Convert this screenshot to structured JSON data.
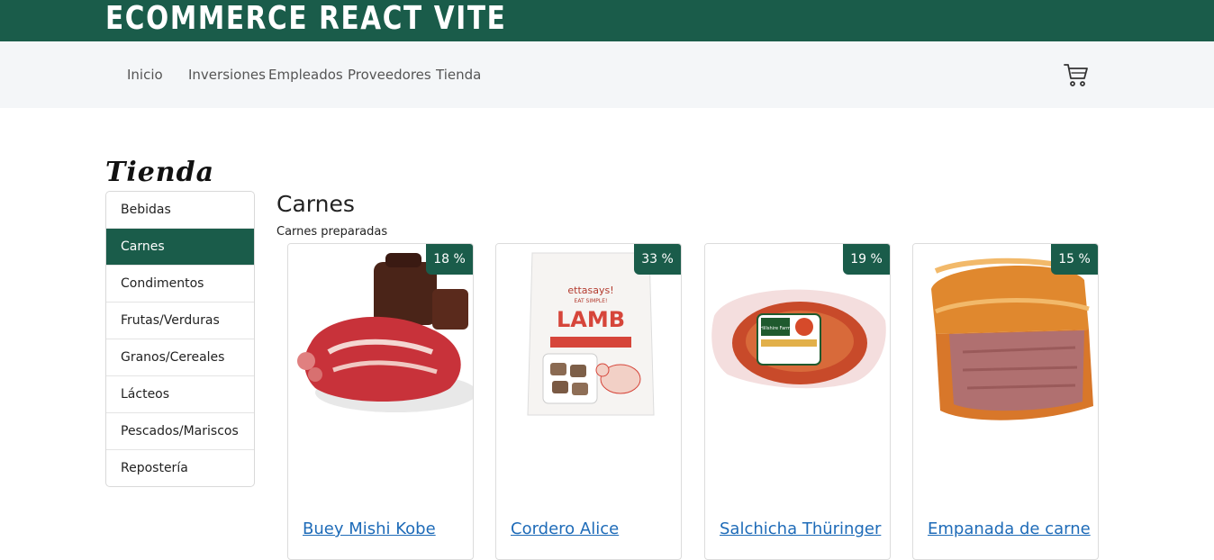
{
  "header": {
    "brand": "ECOMMERCE REACT VITE"
  },
  "nav": {
    "items": [
      {
        "label": "Inicio"
      },
      {
        "label": "Inversiones"
      },
      {
        "label": "Empleados"
      },
      {
        "label": "Proveedores"
      },
      {
        "label": "Tienda"
      }
    ],
    "cart_icon": "cart-icon"
  },
  "page": {
    "title": "Tienda"
  },
  "categories": [
    {
      "label": "Bebidas",
      "active": false
    },
    {
      "label": "Carnes",
      "active": true
    },
    {
      "label": "Condimentos",
      "active": false
    },
    {
      "label": "Frutas/Verduras",
      "active": false
    },
    {
      "label": "Granos/Cereales",
      "active": false
    },
    {
      "label": "Lácteos",
      "active": false
    },
    {
      "label": "Pescados/Mariscos",
      "active": false
    },
    {
      "label": "Repostería",
      "active": false
    }
  ],
  "section": {
    "title": "Carnes",
    "subtitle": "Carnes preparadas"
  },
  "products": [
    {
      "name": "Buey Mishi Kobe",
      "discount": "18 %"
    },
    {
      "name": "Cordero Alice",
      "discount": "33 %",
      "package_brand": "ettasays!",
      "package_tagline": "EAT SIMPLE!",
      "package_title": "LAMB"
    },
    {
      "name": "Salchicha Thüringer",
      "discount": "19 %",
      "package_brand": "Hillshire Farm"
    },
    {
      "name": "Empanada de carne",
      "discount": "15 %"
    }
  ],
  "colors": {
    "brand": "#1a5c4a",
    "nav_bg": "#f4f6f8",
    "link": "#1e6bb8"
  }
}
